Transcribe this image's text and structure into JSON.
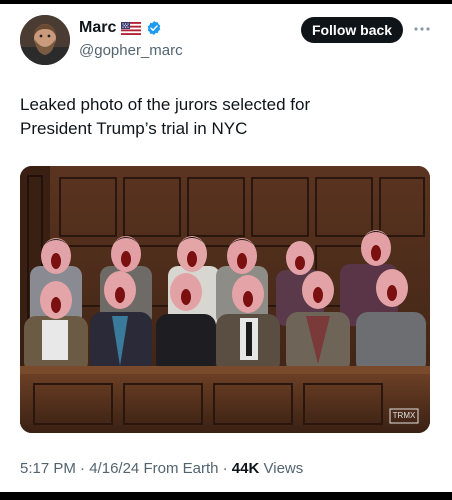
{
  "author": {
    "name": "Marc",
    "handle": "@gopher_marc",
    "flag_icon": "us-flag-icon",
    "badge_icon": "verified-badge-icon"
  },
  "actions": {
    "follow_label": "Follow back",
    "more_icon": "more-horizontal-icon"
  },
  "tweet": {
    "text_line1": "Leaked photo of the jurors selected for",
    "text_line2": "President Trump’s trial in NYC"
  },
  "media": {
    "watermark": "TRMX"
  },
  "meta": {
    "time": "5:17 PM",
    "sep1": "·",
    "date": "4/16/24",
    "source": "From Earth",
    "sep2": "·",
    "views_count": "44K",
    "views_label": "Views"
  },
  "colors": {
    "text_primary": "#0f1419",
    "text_secondary": "#536471",
    "verified_blue": "#1d9bf0",
    "button_bg": "#0f1419"
  }
}
